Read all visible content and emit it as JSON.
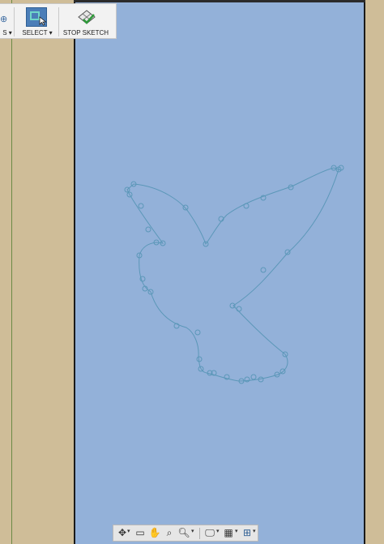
{
  "toolbar": {
    "prev_label": "S",
    "select_label": "SELECT",
    "stop_sketch_label": "STOP SKETCH"
  },
  "colors": {
    "canvas": "#93b1d9",
    "panel": "#cfbd98",
    "sketch_line": "#5b97b8",
    "select_icon": "#4b7eb8"
  },
  "navbar": {
    "icons": [
      "orbit-icon",
      "look-at-icon",
      "pan-icon",
      "zoom-window-icon",
      "zoom-icon",
      "display-settings-icon",
      "grid-icon",
      "viewports-icon"
    ]
  }
}
